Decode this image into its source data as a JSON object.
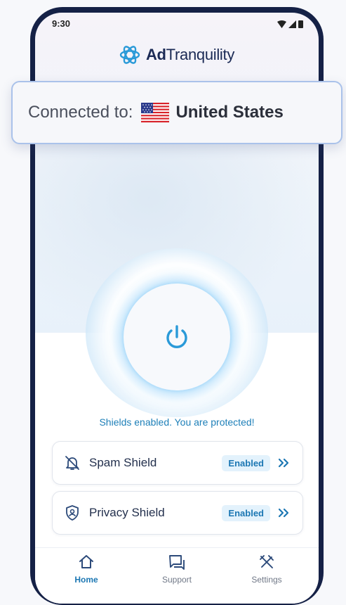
{
  "status_bar": {
    "time": "9:30"
  },
  "app": {
    "brand_prefix": "Ad",
    "brand_suffix": "Tranquility"
  },
  "connection": {
    "prefix": "Connected to:",
    "country": "United States",
    "flag": "us-flag"
  },
  "power": {
    "icon": "power-icon",
    "state": "on"
  },
  "status_message": "Shields enabled. You are protected!",
  "shields": [
    {
      "label": "Spam Shield",
      "status": "Enabled",
      "icon": "bell-off-icon"
    },
    {
      "label": "Privacy Shield",
      "status": "Enabled",
      "icon": "user-shield-icon"
    }
  ],
  "nav": [
    {
      "label": "Home",
      "icon": "home-icon",
      "active": true
    },
    {
      "label": "Support",
      "icon": "chat-icon",
      "active": false
    },
    {
      "label": "Settings",
      "icon": "tools-icon",
      "active": false
    }
  ],
  "colors": {
    "accent": "#1c77b3",
    "frame": "#152146",
    "glow": "#50b4f5"
  }
}
